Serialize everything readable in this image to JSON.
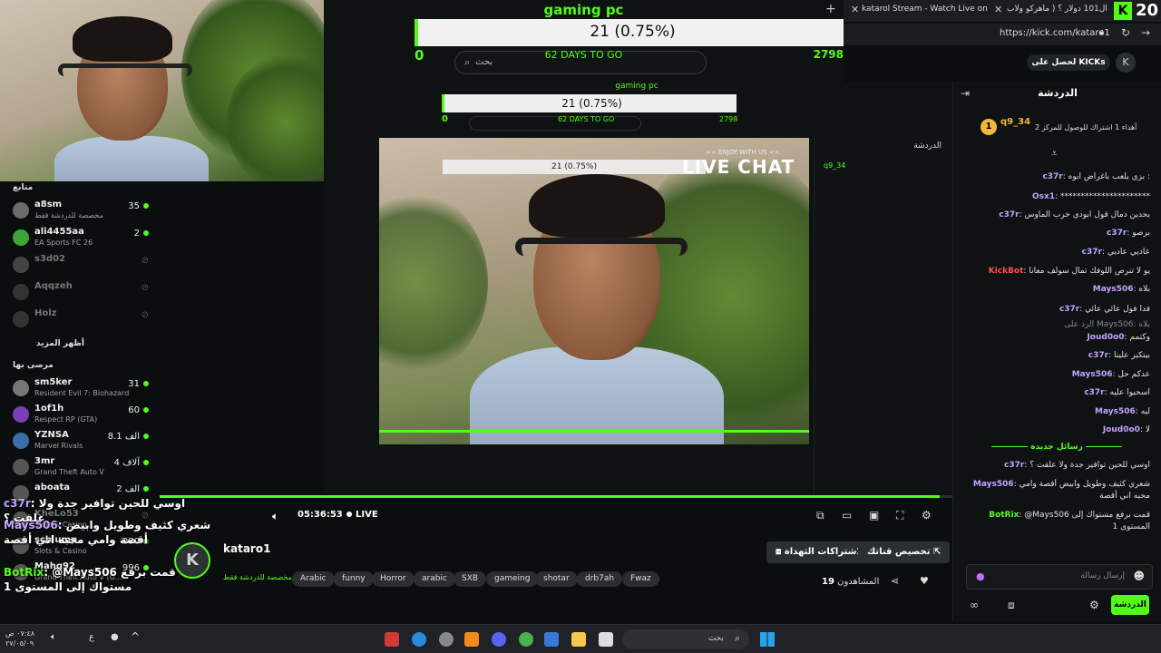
{
  "browser": {
    "tab_title": "katarol Stream - Watch Live on K",
    "tab_title2": "شكلة ال101 دولار ؟ ( ماهركو ولأب",
    "url": "https://kick.com/kataro1",
    "kick_count": "20"
  },
  "goal": {
    "title": "gaming pc",
    "value": "21 (0.75%)",
    "min": "0",
    "max": "2798",
    "days": "62 DAYS TO GO",
    "search_placeholder": "بحث"
  },
  "inner_goal": {
    "title": "gaming pc",
    "value": "21 (0.75%)",
    "min": "0",
    "max": "2798",
    "days": "62 DAYS TO GO",
    "live_chat": "LIVE CHAT",
    "enjoy": ">> ENJOY WITH US <<"
  },
  "header": {
    "kicks_btn": "لحصل على KICKs",
    "chat_title": "الدردشة"
  },
  "chat": {
    "pinned_user": "q9_34",
    "pinned_text": "أهداء 1 اشتراك للوصول للمركز 2",
    "messages": [
      {
        "user": "c37r",
        "text": "بزي يلعب بأغراض ابوه :",
        "color": "purple"
      },
      {
        "user": "Osx1",
        "text": "**********************",
        "color": "purple"
      },
      {
        "user": "c37r",
        "text": "بحدين دمال قول ابودي خرب الماوس",
        "color": "purple"
      },
      {
        "user": "c37r",
        "text": "برصو",
        "color": "purple"
      },
      {
        "user": "c37r",
        "text": "عاديي عاديي",
        "color": "purple"
      },
      {
        "user": "KickBot",
        "text": "يو لا تنرص اللوفك تمال سولف معانا",
        "color": "red"
      },
      {
        "user": "Mays506",
        "text": "بلاه",
        "color": "purple"
      },
      {
        "user": "c37r",
        "text": "فدا فول عائي عائي",
        "color": "purple"
      },
      {
        "user": "",
        "text": "الرد على Mays506: بلاه",
        "color": "gray"
      },
      {
        "user": "Joud0o0",
        "text": "وكتمم",
        "color": "purple"
      },
      {
        "user": "c37r",
        "text": "بيتكبر علينا",
        "color": "purple"
      },
      {
        "user": "Mays506",
        "text": "عدكم حل",
        "color": "purple"
      },
      {
        "user": "c37r",
        "text": "اسحبوا عليه",
        "color": "purple"
      },
      {
        "user": "Mays506",
        "text": "ليه",
        "color": "purple"
      },
      {
        "user": "Joud0o0",
        "text": "لا",
        "color": "purple"
      }
    ],
    "new_messages": "رسائل جديدة",
    "late_messages": [
      {
        "user": "c37r",
        "text": "اوسي للحين توافير جدة ولا علقت ؟"
      },
      {
        "user": "Mays506",
        "text": "شعري كثيف وطويل وابيض أقصة وامي محبه اني أقصة"
      },
      {
        "user": "BotRix",
        "text": "@Mays506 قمت برفع مستواك إلى المستوى 1"
      }
    ],
    "input_placeholder": "إرسال رسالة",
    "send_btn": "الدردشة"
  },
  "sidebar": {
    "section_recommended": "متابع",
    "followed": [
      {
        "name": "a8sm",
        "game": "مخصصة للدردشة فقط",
        "count": "35",
        "color": "#6b6b6b"
      },
      {
        "name": "ali4455aa",
        "game": "EA Sports FC 26",
        "count": "2",
        "color": "#3fa33a"
      },
      {
        "name": "s3d02",
        "game": "",
        "count": "",
        "color": "#444"
      },
      {
        "name": "Aqqzeh",
        "game": "",
        "count": "",
        "color": "#333"
      },
      {
        "name": "Holz",
        "game": "",
        "count": "",
        "color": "#333"
      }
    ],
    "show_more": "أظهر المزيد",
    "section_suggested": "مرصى بها",
    "suggested": [
      {
        "name": "sm5ker",
        "game": "Resident Evil 7: Biohazard",
        "count": "31",
        "color": "#777"
      },
      {
        "name": "1of1h",
        "game": "Respect RP (GTA)",
        "count": "60",
        "color": "#7b3fb3"
      },
      {
        "name": "YZNSA",
        "game": "Marvel Rivals",
        "count": "8.1 الف",
        "color": "#3a6ea5"
      },
      {
        "name": "3mr",
        "game": "Grand Theft Auto V",
        "count": "4 آلاف",
        "color": "#555"
      },
      {
        "name": "aboata",
        "game": "",
        "count": "2 الف",
        "color": "#555"
      },
      {
        "name": "KheLo53",
        "game": "Slots & Casino",
        "count": "",
        "color": "#555"
      },
      {
        "name": "schlump",
        "game": "Slots & Casino",
        "count": "380",
        "color": "#555"
      },
      {
        "name": "Mahg92",
        "game": "Grand Theft Auto V (G...",
        "count": "996",
        "color": "#555"
      }
    ]
  },
  "overlay_chat": [
    {
      "user": "c37r",
      "text": "اوسي للحين توافير جدة ولا علقت ؟"
    },
    {
      "user": "Mays506",
      "text": "شعري كثيف وطويل وابيض أقصة وامي محبه اني أقصة"
    },
    {
      "user": "BotRix",
      "text": "@Mays506 قمت برفع مستواك إلى المستوى 1"
    }
  ],
  "player": {
    "time": "05:36:53",
    "live": "LIVE"
  },
  "stream": {
    "channel": "kataro1",
    "category": "مخصصة للدردشة فقط",
    "tags": [
      "Arabic",
      "funny",
      "Horror",
      "arabic",
      "SXB",
      "gameing",
      "shotar",
      "drb7ah",
      "Fwaz"
    ],
    "subscribe_btn": "تخصيص قناتك",
    "gift_btn": "الاشتراكات الثهداة",
    "viewers_label": "المشاهدون",
    "viewers": "19"
  },
  "taskbar": {
    "search": "بحث",
    "time": "٠٧:٤٨ ص",
    "date": "٢٧/٠٥/٠٩",
    "lang": "ع"
  }
}
